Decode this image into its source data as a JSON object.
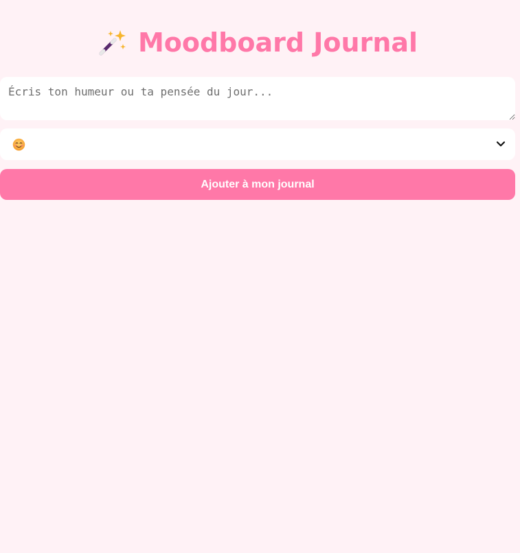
{
  "app": {
    "title_icon": "magic-wand-icon",
    "title": "Moodboard Journal",
    "accent_color": "#ff78a8",
    "background_color": "#fff2f6"
  },
  "entry_form": {
    "note_placeholder": "Écris ton humeur ou ta pensée du jour...",
    "note_value": "",
    "mood_select": {
      "selected_icon": "smiling-face-emoji-icon"
    },
    "submit_label": "Ajouter à mon journal"
  }
}
